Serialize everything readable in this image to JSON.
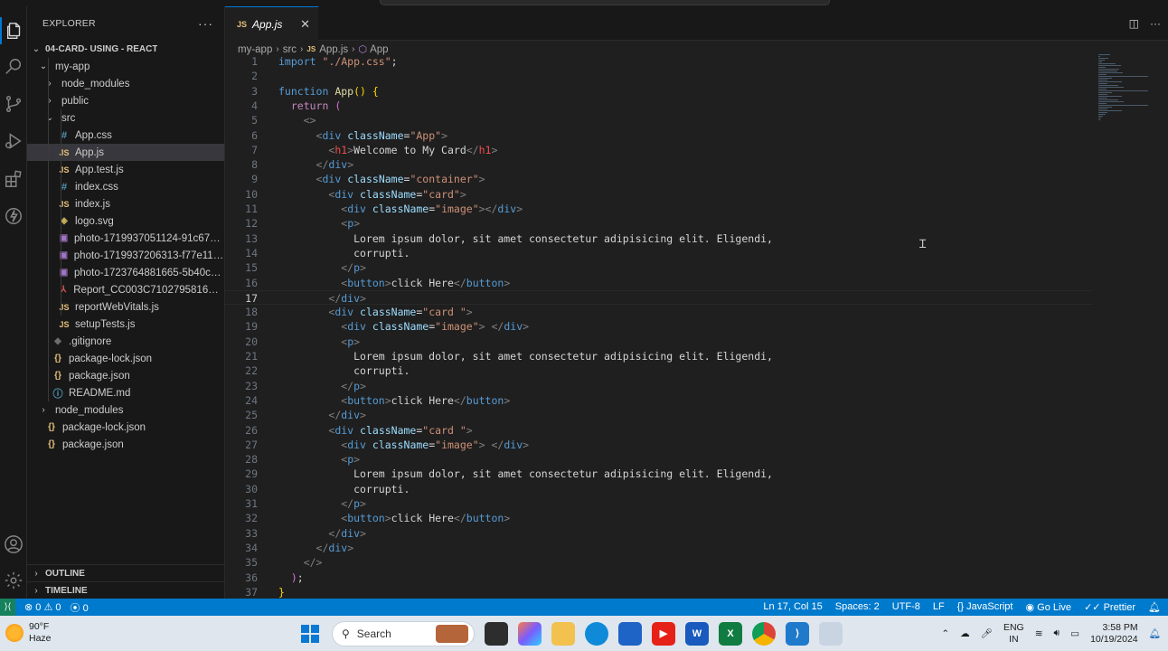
{
  "explorer": {
    "title": "EXPLORER",
    "more": "···",
    "workspace": "04-CARD- USING - REACT",
    "items": [
      {
        "label": "my-app",
        "kind": "folder-open",
        "depth": 1
      },
      {
        "label": "node_modules",
        "kind": "folder",
        "depth": 2
      },
      {
        "label": "public",
        "kind": "folder",
        "depth": 2
      },
      {
        "label": "src",
        "kind": "folder-open",
        "depth": 2
      },
      {
        "label": "App.css",
        "kind": "css",
        "depth": 3
      },
      {
        "label": "App.js",
        "kind": "js",
        "depth": 3,
        "selected": true
      },
      {
        "label": "App.test.js",
        "kind": "js",
        "depth": 3
      },
      {
        "label": "index.css",
        "kind": "css",
        "depth": 3
      },
      {
        "label": "index.js",
        "kind": "js",
        "depth": 3
      },
      {
        "label": "logo.svg",
        "kind": "svg",
        "depth": 3
      },
      {
        "label": "photo-1719937051124-91c677bc...",
        "kind": "img",
        "depth": 3
      },
      {
        "label": "photo-1719937206313-f77e1173c...",
        "kind": "img",
        "depth": 3
      },
      {
        "label": "photo-1723764881665-5b40cea0...",
        "kind": "img",
        "depth": 3
      },
      {
        "label": "Report_CC003C71027958167684_...",
        "kind": "pdf",
        "depth": 3
      },
      {
        "label": "reportWebVitals.js",
        "kind": "js",
        "depth": 3
      },
      {
        "label": "setupTests.js",
        "kind": "js",
        "depth": 3
      },
      {
        "label": ".gitignore",
        "kind": "git",
        "depth": 2
      },
      {
        "label": "package-lock.json",
        "kind": "json",
        "depth": 2
      },
      {
        "label": "package.json",
        "kind": "json",
        "depth": 2
      },
      {
        "label": "README.md",
        "kind": "info",
        "depth": 2
      },
      {
        "label": "node_modules",
        "kind": "folder",
        "depth": 1
      },
      {
        "label": "package-lock.json",
        "kind": "json",
        "depth": 1
      },
      {
        "label": "package.json",
        "kind": "json",
        "depth": 1
      }
    ],
    "outline": "OUTLINE",
    "timeline": "TIMELINE"
  },
  "editor": {
    "tab": {
      "badge": "JS",
      "label": "App.js",
      "close": "✕"
    },
    "breadcrumb": [
      "my-app",
      "src",
      "App.js",
      "App"
    ],
    "cursor_line": 17,
    "lines": [
      [
        [
          "kb",
          "import"
        ],
        [
          "tx",
          " "
        ],
        [
          "s",
          "\"./App.css\""
        ],
        [
          "tx",
          ";"
        ]
      ],
      [],
      [
        [
          "kb",
          "function"
        ],
        [
          "tx",
          " "
        ],
        [
          "f",
          "App"
        ],
        [
          "p",
          "()"
        ],
        [
          "tx",
          " "
        ],
        [
          "p",
          "{"
        ]
      ],
      [
        [
          "tx",
          "  "
        ],
        [
          "k",
          "return"
        ],
        [
          "tx",
          " "
        ],
        [
          "p2",
          "("
        ]
      ],
      [
        [
          "tx",
          "    "
        ],
        [
          "t",
          "<>"
        ]
      ],
      [
        [
          "tx",
          "      "
        ],
        [
          "t",
          "<"
        ],
        [
          "tg",
          "div"
        ],
        [
          "tx",
          " "
        ],
        [
          "at",
          "className"
        ],
        [
          "tx",
          "="
        ],
        [
          "s",
          "\"App\""
        ],
        [
          "t",
          ">"
        ]
      ],
      [
        [
          "tx",
          "        "
        ],
        [
          "t",
          "<"
        ],
        [
          "tr",
          "h1"
        ],
        [
          "t",
          ">"
        ],
        [
          "tx",
          "Welcome to My Card"
        ],
        [
          "t",
          "</"
        ],
        [
          "tr",
          "h1"
        ],
        [
          "t",
          ">"
        ]
      ],
      [
        [
          "tx",
          "      "
        ],
        [
          "t",
          "</"
        ],
        [
          "tg",
          "div"
        ],
        [
          "t",
          ">"
        ]
      ],
      [
        [
          "tx",
          "      "
        ],
        [
          "t",
          "<"
        ],
        [
          "tg",
          "div"
        ],
        [
          "tx",
          " "
        ],
        [
          "at",
          "className"
        ],
        [
          "tx",
          "="
        ],
        [
          "s",
          "\"container\""
        ],
        [
          "t",
          ">"
        ]
      ],
      [
        [
          "tx",
          "        "
        ],
        [
          "t",
          "<"
        ],
        [
          "tg",
          "div"
        ],
        [
          "tx",
          " "
        ],
        [
          "at",
          "className"
        ],
        [
          "tx",
          "="
        ],
        [
          "s",
          "\"card\""
        ],
        [
          "t",
          ">"
        ]
      ],
      [
        [
          "tx",
          "          "
        ],
        [
          "t",
          "<"
        ],
        [
          "tg",
          "div"
        ],
        [
          "tx",
          " "
        ],
        [
          "at",
          "className"
        ],
        [
          "tx",
          "="
        ],
        [
          "s",
          "\"image\""
        ],
        [
          "t",
          "></"
        ],
        [
          "tg",
          "div"
        ],
        [
          "t",
          ">"
        ]
      ],
      [
        [
          "tx",
          "          "
        ],
        [
          "t",
          "<"
        ],
        [
          "tg",
          "p"
        ],
        [
          "t",
          ">"
        ]
      ],
      [
        [
          "tx",
          "            Lorem ipsum dolor, sit amet consectetur adipisicing elit. Eligendi,"
        ]
      ],
      [
        [
          "tx",
          "            corrupti."
        ]
      ],
      [
        [
          "tx",
          "          "
        ],
        [
          "t",
          "</"
        ],
        [
          "tg",
          "p"
        ],
        [
          "t",
          ">"
        ]
      ],
      [
        [
          "tx",
          "          "
        ],
        [
          "t",
          "<"
        ],
        [
          "tg",
          "button"
        ],
        [
          "t",
          ">"
        ],
        [
          "tx",
          "click Here"
        ],
        [
          "t",
          "</"
        ],
        [
          "tg",
          "button"
        ],
        [
          "t",
          ">"
        ]
      ],
      [
        [
          "tx",
          "        "
        ],
        [
          "t",
          "</"
        ],
        [
          "tg",
          "div"
        ],
        [
          "t",
          ">"
        ]
      ],
      [
        [
          "tx",
          "        "
        ],
        [
          "t",
          "<"
        ],
        [
          "tg",
          "div"
        ],
        [
          "tx",
          " "
        ],
        [
          "at",
          "className"
        ],
        [
          "tx",
          "="
        ],
        [
          "s",
          "\"card \""
        ],
        [
          "t",
          ">"
        ]
      ],
      [
        [
          "tx",
          "          "
        ],
        [
          "t",
          "<"
        ],
        [
          "tg",
          "div"
        ],
        [
          "tx",
          " "
        ],
        [
          "at",
          "className"
        ],
        [
          "tx",
          "="
        ],
        [
          "s",
          "\"image\""
        ],
        [
          "t",
          ">"
        ],
        [
          "tx",
          " "
        ],
        [
          "t",
          "</"
        ],
        [
          "tg",
          "div"
        ],
        [
          "t",
          ">"
        ]
      ],
      [
        [
          "tx",
          "          "
        ],
        [
          "t",
          "<"
        ],
        [
          "tg",
          "p"
        ],
        [
          "t",
          ">"
        ]
      ],
      [
        [
          "tx",
          "            Lorem ipsum dolor, sit amet consectetur adipisicing elit. Eligendi,"
        ]
      ],
      [
        [
          "tx",
          "            corrupti."
        ]
      ],
      [
        [
          "tx",
          "          "
        ],
        [
          "t",
          "</"
        ],
        [
          "tg",
          "p"
        ],
        [
          "t",
          ">"
        ]
      ],
      [
        [
          "tx",
          "          "
        ],
        [
          "t",
          "<"
        ],
        [
          "tg",
          "button"
        ],
        [
          "t",
          ">"
        ],
        [
          "tx",
          "click Here"
        ],
        [
          "t",
          "</"
        ],
        [
          "tg",
          "button"
        ],
        [
          "t",
          ">"
        ]
      ],
      [
        [
          "tx",
          "        "
        ],
        [
          "t",
          "</"
        ],
        [
          "tg",
          "div"
        ],
        [
          "t",
          ">"
        ]
      ],
      [
        [
          "tx",
          "        "
        ],
        [
          "t",
          "<"
        ],
        [
          "tg",
          "div"
        ],
        [
          "tx",
          " "
        ],
        [
          "at",
          "className"
        ],
        [
          "tx",
          "="
        ],
        [
          "s",
          "\"card \""
        ],
        [
          "t",
          ">"
        ]
      ],
      [
        [
          "tx",
          "          "
        ],
        [
          "t",
          "<"
        ],
        [
          "tg",
          "div"
        ],
        [
          "tx",
          " "
        ],
        [
          "at",
          "className"
        ],
        [
          "tx",
          "="
        ],
        [
          "s",
          "\"image\""
        ],
        [
          "t",
          ">"
        ],
        [
          "tx",
          " "
        ],
        [
          "t",
          "</"
        ],
        [
          "tg",
          "div"
        ],
        [
          "t",
          ">"
        ]
      ],
      [
        [
          "tx",
          "          "
        ],
        [
          "t",
          "<"
        ],
        [
          "tg",
          "p"
        ],
        [
          "t",
          ">"
        ]
      ],
      [
        [
          "tx",
          "            Lorem ipsum dolor, sit amet consectetur adipisicing elit. Eligendi,"
        ]
      ],
      [
        [
          "tx",
          "            corrupti."
        ]
      ],
      [
        [
          "tx",
          "          "
        ],
        [
          "t",
          "</"
        ],
        [
          "tg",
          "p"
        ],
        [
          "t",
          ">"
        ]
      ],
      [
        [
          "tx",
          "          "
        ],
        [
          "t",
          "<"
        ],
        [
          "tg",
          "button"
        ],
        [
          "t",
          ">"
        ],
        [
          "tx",
          "click Here"
        ],
        [
          "t",
          "</"
        ],
        [
          "tg",
          "button"
        ],
        [
          "t",
          ">"
        ]
      ],
      [
        [
          "tx",
          "        "
        ],
        [
          "t",
          "</"
        ],
        [
          "tg",
          "div"
        ],
        [
          "t",
          ">"
        ]
      ],
      [
        [
          "tx",
          "      "
        ],
        [
          "t",
          "</"
        ],
        [
          "tg",
          "div"
        ],
        [
          "t",
          ">"
        ]
      ],
      [
        [
          "tx",
          "    "
        ],
        [
          "t",
          "</>"
        ]
      ],
      [
        [
          "tx",
          "  "
        ],
        [
          "p2",
          ")"
        ],
        [
          "tx",
          ";"
        ]
      ],
      [
        [
          "p",
          "}"
        ]
      ]
    ]
  },
  "statusbar": {
    "errors": "0",
    "warnings": "0",
    "ports": "0",
    "position": "Ln 17, Col 15",
    "spaces": "Spaces: 2",
    "encoding": "UTF-8",
    "eol": "LF",
    "language": "JavaScript",
    "golive": "Go Live",
    "prettier": "Prettier"
  },
  "taskbar": {
    "temperature": "90°F",
    "weather": "Haze",
    "search_placeholder": "Search",
    "language_line1": "ENG",
    "language_line2": "IN",
    "time": "3:58 PM",
    "date": "10/19/2024"
  },
  "colors": {
    "accent": "#007acc",
    "editor_bg": "#1f1f1f",
    "sidebar_bg": "#181818"
  }
}
